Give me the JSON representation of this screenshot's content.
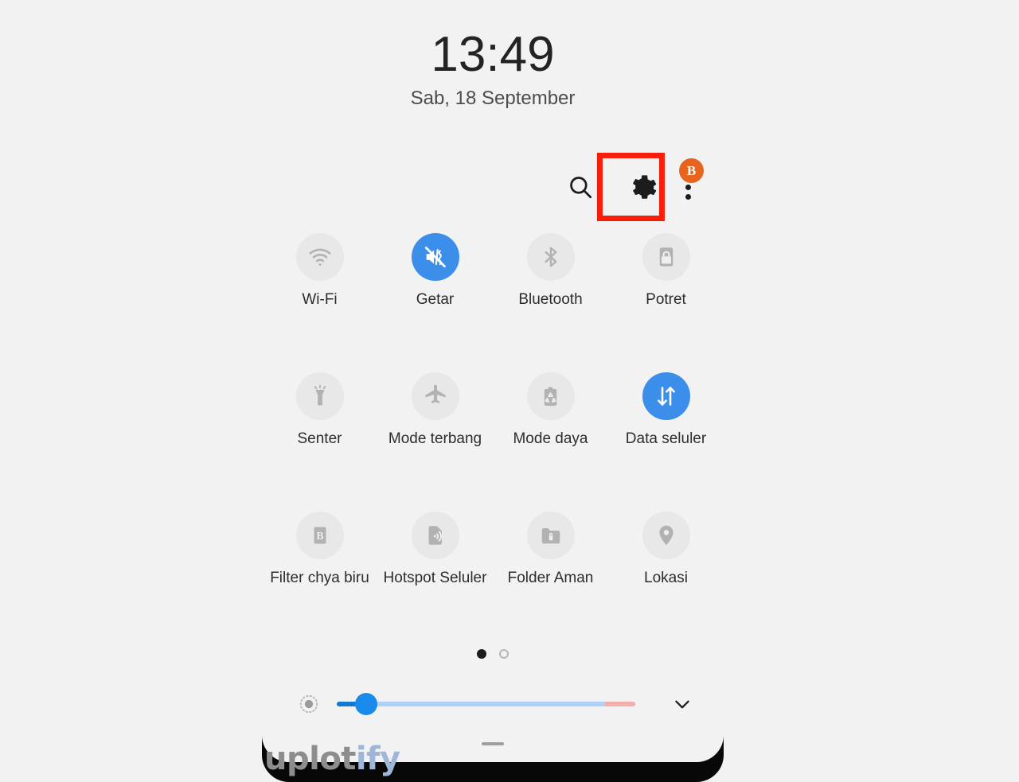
{
  "status": {
    "time": "13:49",
    "date": "Sab, 18 September"
  },
  "toolbar": {
    "search_label": "search-icon",
    "settings_label": "gear-icon",
    "more_label": "more-options-icon",
    "badge_text": "B",
    "badge_color": "#e8641c",
    "highlight_color": "#f71e0c",
    "highlight_target": "gear-icon"
  },
  "tiles": [
    [
      {
        "label": "Wi-Fi",
        "icon": "wifi-icon",
        "active": false
      },
      {
        "label": "Getar",
        "icon": "vibrate-icon",
        "active": true
      },
      {
        "label": "Bluetooth",
        "icon": "bluetooth-icon",
        "active": false
      },
      {
        "label": "Potret",
        "icon": "rotation-lock-icon",
        "active": false
      }
    ],
    [
      {
        "label": "Senter",
        "icon": "flashlight-icon",
        "active": false
      },
      {
        "label": "Mode terbang",
        "icon": "airplane-icon",
        "active": false
      },
      {
        "label": "Mode daya",
        "icon": "power-saving-icon",
        "active": false
      },
      {
        "label": "Data seluler",
        "icon": "mobile-data-icon",
        "active": true
      }
    ],
    [
      {
        "label": "Filter chya biru",
        "icon": "blue-light-filter-icon",
        "active": false
      },
      {
        "label": "Hotspot Seluler",
        "icon": "hotspot-icon",
        "active": false
      },
      {
        "label": "Folder Aman",
        "icon": "secure-folder-icon",
        "active": false
      },
      {
        "label": "Lokasi",
        "icon": "location-pin-icon",
        "active": false
      }
    ]
  ],
  "pager": {
    "pages": 2,
    "current": 1
  },
  "brightness": {
    "icon": "brightness-icon",
    "value_percent": 13,
    "expand_icon": "chevron-down-icon",
    "track_color": "#aed2f6",
    "fill_color": "#1479d6",
    "warn_color": "#f3afac"
  },
  "accents": {
    "tile_active": "#3b8eea",
    "tile_inactive": "#e8e8e8",
    "panel_bg": "#f2f2f2"
  },
  "watermark": {
    "part1": "uplot",
    "part2": "ify"
  }
}
